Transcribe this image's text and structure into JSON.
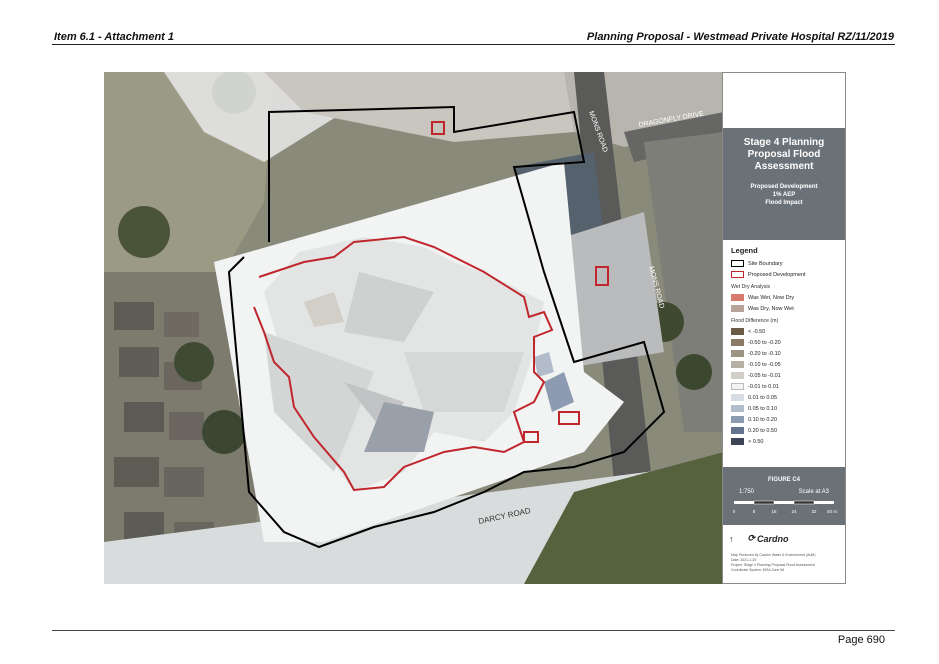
{
  "header": {
    "left": "Item 6.1 - Attachment 1",
    "right": "Planning Proposal - Westmead Private Hospital RZ/11/2019"
  },
  "footer": {
    "page": "Page 690"
  },
  "map": {
    "street_labels": [
      "MONS ROAD",
      "DRAGONFLY DRIVE",
      "MONS ROAD",
      "DARCY ROAD"
    ]
  },
  "panel": {
    "title": "Stage 4 Planning Proposal Flood Assessment",
    "subtitle_lines": [
      "Proposed Development",
      "1% AEP",
      "Flood Impact"
    ],
    "legend": {
      "heading": "Legend",
      "boundary": [
        {
          "label": "Site Boundary",
          "stroke": "#000000"
        },
        {
          "label": "Proposed Development",
          "stroke": "#c0272d"
        }
      ],
      "wetdry_heading": "Wet Dry Analysis",
      "wetdry": [
        {
          "label": "Was Wet, Now Dry",
          "color": "#d97a6e"
        },
        {
          "label": "Was Dry, Now Wet",
          "color": "#b8a39a"
        }
      ],
      "flood_heading": "Flood Difference (m)",
      "flood": [
        {
          "label": "< -0.50",
          "color": "#6b5a45"
        },
        {
          "label": "-0.50 to -0.20",
          "color": "#8a7a64"
        },
        {
          "label": "-0.20 to -0.10",
          "color": "#9e9484"
        },
        {
          "label": "-0.10 to -0.05",
          "color": "#b6b0a4"
        },
        {
          "label": "-0.05 to -0.01",
          "color": "#d2cfc8"
        },
        {
          "label": "-0.01 to 0.01",
          "color": "#f4f4f4"
        },
        {
          "label": "0.01 to 0.05",
          "color": "#d7dbe3"
        },
        {
          "label": "0.05 to 0.10",
          "color": "#b2bccb"
        },
        {
          "label": "0.10 to 0.20",
          "color": "#8d9bb2"
        },
        {
          "label": "0.20 to 0.50",
          "color": "#65748e"
        },
        {
          "label": "> 0.50",
          "color": "#3c4455"
        }
      ]
    },
    "figure": {
      "label": "FIGURE C4",
      "scale": "1:750",
      "scale_at": "Scale at A3",
      "ticks": [
        "0",
        "8",
        "16",
        "24",
        "32",
        "40 m"
      ]
    },
    "logo": "Cardno",
    "notes": [
      "Map Produced by Cardno Water & Environment (AuM)",
      "Date: 2021-1-25",
      "Project: Stage 4 Planning Proposal Flood Assessment",
      "Coordinate System: MGA Zone 56"
    ]
  }
}
